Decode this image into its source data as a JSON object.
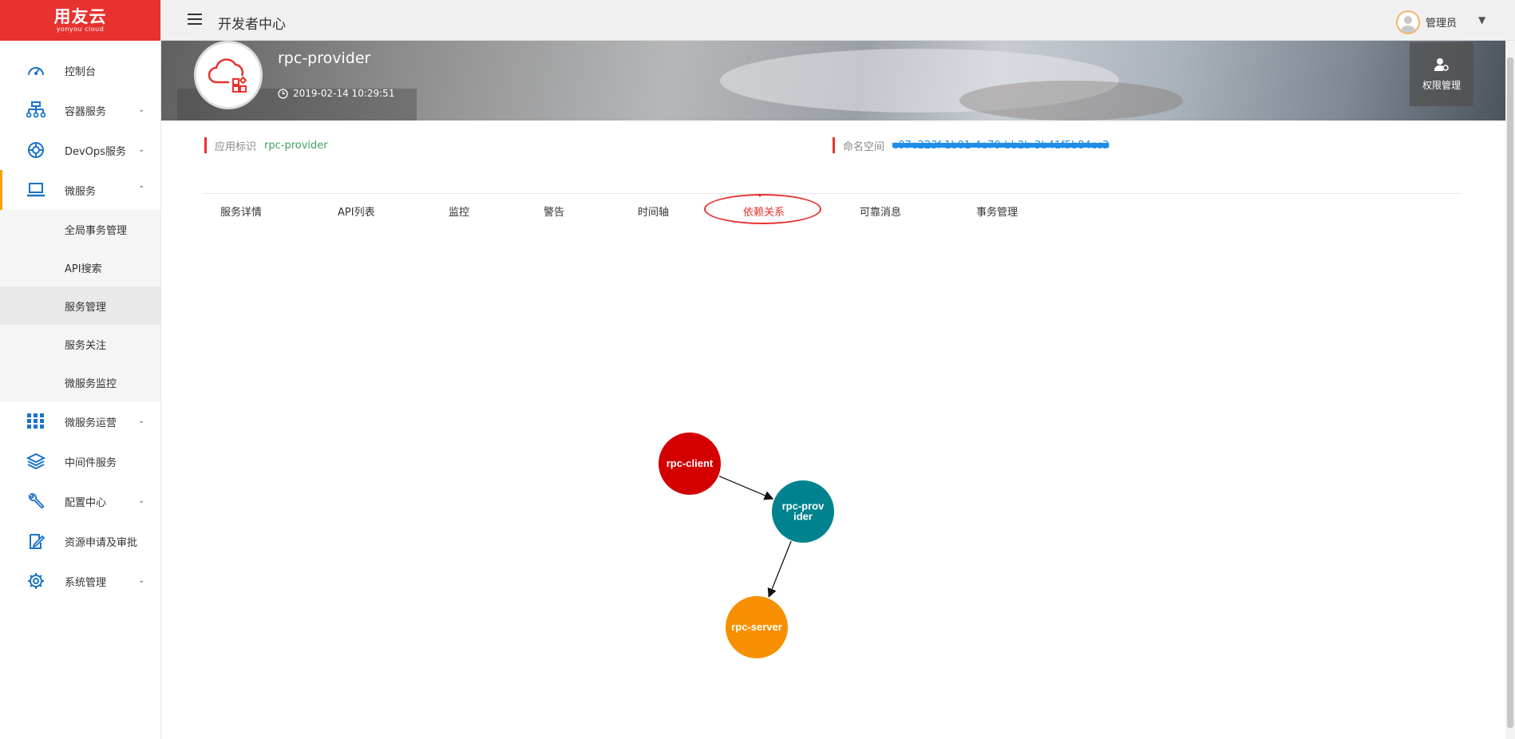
{
  "sidebar": {
    "logo": {
      "brand": "用友云",
      "sub": "yonyou cloud"
    },
    "items": [
      {
        "label": "控制台",
        "icon": "dashboard-icon"
      },
      {
        "label": "容器服务",
        "icon": "container-icon"
      },
      {
        "label": "DevOps服务",
        "icon": "devops-icon"
      },
      {
        "label": "微服务",
        "icon": "laptop-icon"
      },
      {
        "label": "微服务运营",
        "icon": "grid-icon"
      },
      {
        "label": "中间件服务",
        "icon": "layers-icon"
      },
      {
        "label": "配置中心",
        "icon": "wrench-icon"
      },
      {
        "label": "资源申请及审批",
        "icon": "edit-icon"
      },
      {
        "label": "系统管理",
        "icon": "gear-icon"
      }
    ],
    "submenu": [
      {
        "label": "全局事务管理"
      },
      {
        "label": "API搜索"
      },
      {
        "label": "服务管理"
      },
      {
        "label": "服务关注"
      },
      {
        "label": "微服务监控"
      }
    ]
  },
  "header": {
    "title": "开发者中心",
    "user": "管理员"
  },
  "app": {
    "name": "rpc-provider",
    "created_time": "2019-02-14 10:29:51",
    "permission_button": "权限管理"
  },
  "info": {
    "app_id_label": "应用标识",
    "app_id_value": "rpc-provider",
    "namespace_label": "命名空间",
    "namespace_value": "c07e223f-1b01-4e70-bb2b-3b41f5b84cc3"
  },
  "tabs": [
    {
      "label": "服务详情"
    },
    {
      "label": "API列表"
    },
    {
      "label": "监控"
    },
    {
      "label": "警告"
    },
    {
      "label": "时间轴"
    },
    {
      "label": "依赖关系"
    },
    {
      "label": "可靠消息"
    },
    {
      "label": "事务管理"
    }
  ],
  "active_tab": "依赖关系",
  "graph": {
    "nodes": [
      {
        "id": "rpc-client",
        "label_lines": [
          "rpc-client"
        ],
        "color": "#d40000"
      },
      {
        "id": "rpc-provider",
        "label_lines": [
          "rpc-prov",
          "ider"
        ],
        "color": "#00838f"
      },
      {
        "id": "rpc-server",
        "label_lines": [
          "rpc-server"
        ],
        "color": "#f79000"
      }
    ],
    "edges": [
      {
        "from": "rpc-client",
        "to": "rpc-provider"
      },
      {
        "from": "rpc-provider",
        "to": "rpc-server"
      }
    ]
  },
  "colors": {
    "brand_red": "#e8322f",
    "accent_orange": "#f7a100",
    "value_green": "#3aa35c"
  }
}
